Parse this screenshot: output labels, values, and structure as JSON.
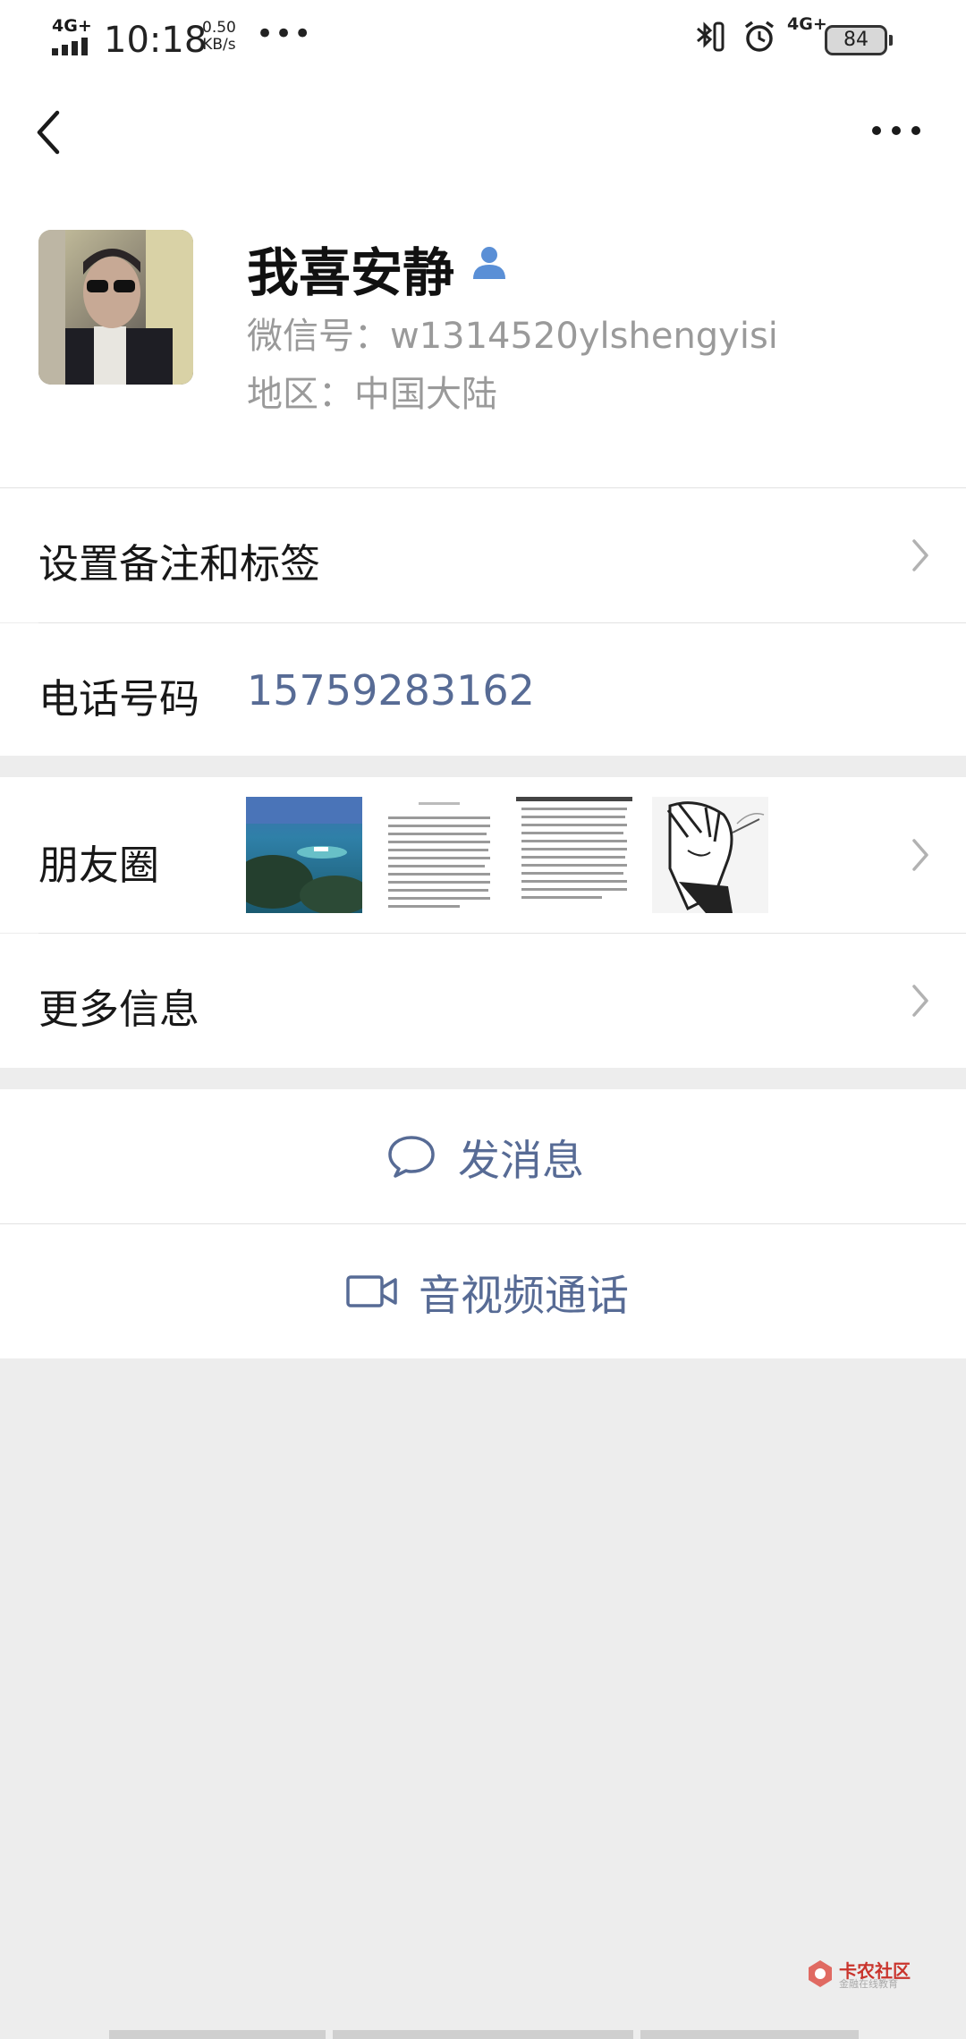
{
  "status_bar": {
    "network_left": "4G+",
    "time": "10:18",
    "speed_value": "0.50",
    "speed_unit": "KB/s",
    "overflow": "•••",
    "network_right": "4G+",
    "battery": "84"
  },
  "profile": {
    "name": "我喜安静",
    "wechat_id": "微信号：w1314520ylshengyisi",
    "region": "地区：中国大陆"
  },
  "rows": {
    "remark_label": "设置备注和标签",
    "phone_label": "电话号码",
    "phone_value": "15759283162",
    "moments_label": "朋友圈",
    "more_info_label": "更多信息"
  },
  "actions": {
    "message_label": "发消息",
    "call_label": "音视频通话"
  },
  "watermark": {
    "title": "卡农社区",
    "subtitle": "金融在线教育"
  },
  "colors": {
    "link": "#576b95",
    "background": "#ededed"
  }
}
